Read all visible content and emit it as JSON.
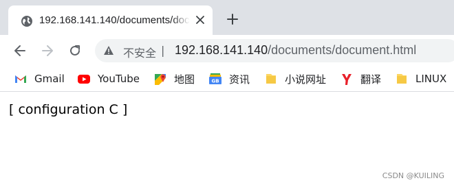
{
  "tab": {
    "title": "192.168.141.140/documents/document.html",
    "favicon": "globe-icon",
    "close": "close-icon"
  },
  "new_tab": "plus-icon",
  "toolbar": {
    "back": "back-arrow-icon",
    "forward": "forward-arrow-icon",
    "reload": "reload-icon",
    "security_icon": "warning-icon",
    "security_label": "不安全",
    "url_host": "192.168.141.140",
    "url_path": "/documents/document.html"
  },
  "bookmarks": [
    {
      "label": "Gmail",
      "icon": "gmail-icon"
    },
    {
      "label": "YouTube",
      "icon": "youtube-icon"
    },
    {
      "label": "地图",
      "icon": "maps-icon"
    },
    {
      "label": "资讯",
      "icon": "news-icon"
    },
    {
      "label": "小说网址",
      "icon": "folder-icon"
    },
    {
      "label": "翻译",
      "icon": "translate-icon"
    },
    {
      "label": "LINUX",
      "icon": "folder-icon"
    }
  ],
  "content": {
    "text": "[ configuration C ]"
  },
  "watermark": "CSDN @KUILING",
  "colors": {
    "tabstrip": "#dee1e6",
    "omnibox": "#f1f3f4",
    "gmail_red": "#ea4335",
    "youtube_red": "#ff0000",
    "folder_yellow": "#fdd663",
    "translate_red": "#e8202a"
  }
}
